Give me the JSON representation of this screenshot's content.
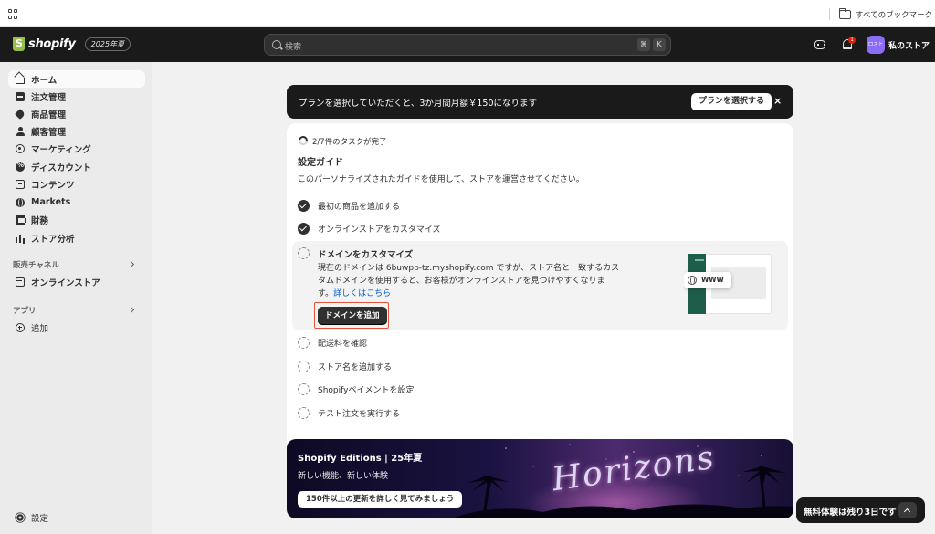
{
  "browser": {
    "bookmarks_label": "すべてのブックマーク"
  },
  "topbar": {
    "brand": "shopify",
    "edition_badge": "2025年夏",
    "search_placeholder": "検索",
    "shortcut_keys": [
      "⌘",
      "K"
    ],
    "notification_count": "1",
    "store_avatar_text": "ロスト",
    "store_name": "私のストア"
  },
  "sidebar": {
    "items": [
      {
        "label": "ホーム",
        "icon": "home-icon",
        "active": true
      },
      {
        "label": "注文管理",
        "icon": "inbox-icon"
      },
      {
        "label": "商品管理",
        "icon": "tag-icon"
      },
      {
        "label": "顧客管理",
        "icon": "person-icon"
      },
      {
        "label": "マーケティング",
        "icon": "target-icon"
      },
      {
        "label": "ディスカウント",
        "icon": "discount-icon"
      },
      {
        "label": "コンテンツ",
        "icon": "content-icon"
      },
      {
        "label": "Markets",
        "icon": "globe-icon"
      },
      {
        "label": "財務",
        "icon": "bank-icon"
      },
      {
        "label": "ストア分析",
        "icon": "chart-icon"
      }
    ],
    "sales_channels_label": "販売チャネル",
    "online_store_label": "オンラインストア",
    "apps_label": "アプリ",
    "add_label": "追加",
    "settings_label": "設定"
  },
  "banner": {
    "text": "プランを選択していただくと、3か月間月額￥150になります",
    "button": "プランを選択する",
    "close": "×"
  },
  "setup_guide": {
    "progress_text": "2/7件のタスクが完了",
    "title": "設定ガイド",
    "description": "このパーソナライズされたガイドを使用して、ストアを運営させてください。",
    "tasks": [
      {
        "label": "最初の商品を追加する",
        "done": true
      },
      {
        "label": "オンラインストアをカスタマイズ",
        "done": true
      },
      {
        "label": "ドメインをカスタマイズ",
        "done": false,
        "expanded": true
      },
      {
        "label": "配送料を確認",
        "done": false
      },
      {
        "label": "ストア名を追加する",
        "done": false
      },
      {
        "label": "Shopifyペイメントを設定",
        "done": false
      },
      {
        "label": "テスト注文を実行する",
        "done": false
      }
    ],
    "expanded_desc_line1": "現在のドメインは 6buwpp-tz.myshopify.com ですが、ストア名と一致するカス",
    "expanded_desc_line2": "タムドメインを使用すると、お客様がオンラインストアを見つけやすくなりま",
    "expanded_desc_line3": "す。",
    "expanded_link": "詳しくはこちら",
    "expanded_button": "ドメインを追加",
    "illustration_text": "WWW"
  },
  "promo": {
    "title": "Shopify Editions | 25年夏",
    "subtitle": "新しい機能、新しい体験",
    "button": "150件以上の更新を詳しく見てみましょう",
    "art_text": "Horizons"
  },
  "trial": {
    "text": "無料体験は残り3日です"
  }
}
